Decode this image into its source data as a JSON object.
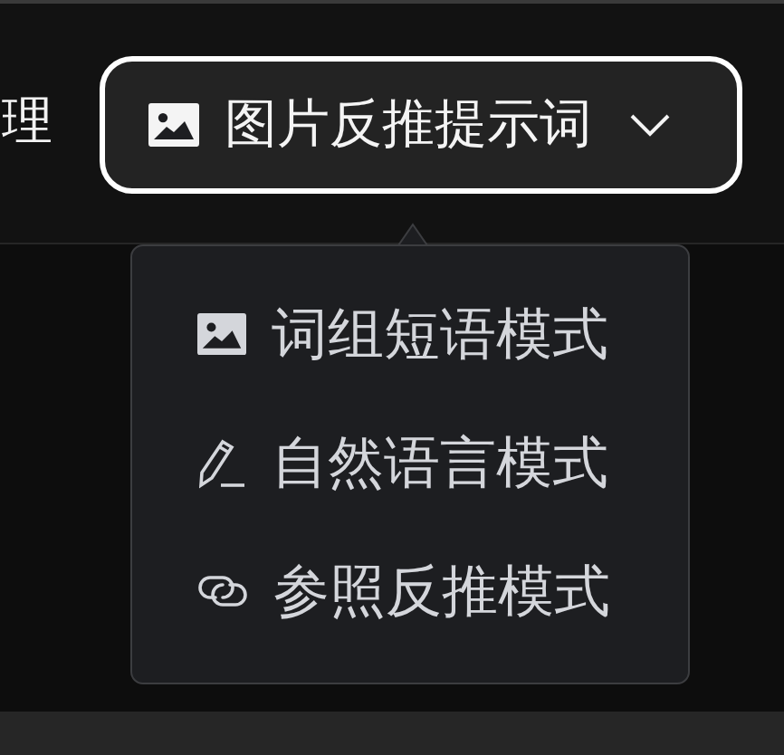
{
  "nav": {
    "label": "理"
  },
  "mode_button": {
    "label": "图片反推提示词",
    "expanded": true
  },
  "menu": {
    "items": [
      {
        "kind": "image",
        "label": "词组短语模式"
      },
      {
        "kind": "pen",
        "label": "自然语言模式"
      },
      {
        "kind": "link",
        "label": "参照反推模式"
      }
    ]
  }
}
